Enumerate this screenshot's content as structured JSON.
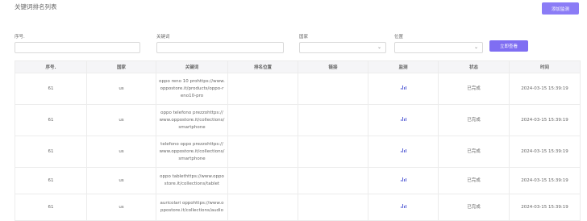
{
  "header": {
    "title": "关键词排名列表",
    "add_button": "添加监测"
  },
  "filters": {
    "seq_label": "序号.",
    "keyword_label": "关键词",
    "country_label": "国家",
    "position_label": "位置",
    "search_button": "立即查看"
  },
  "table": {
    "columns": [
      "序号.",
      "国家",
      "关键词",
      "排名位置",
      "链接",
      "监测",
      "状态",
      "时间"
    ],
    "rows": [
      {
        "id": "61",
        "country": "us",
        "keyword": "oppo reno 10 prohttps://www.oppostore.it/products/oppo-reno10-pro",
        "rank": "",
        "link": "",
        "monitor_icon": "bar-chart-icon",
        "status": "已完成",
        "time": "2024-03-15 15:39:19"
      },
      {
        "id": "61",
        "country": "us",
        "keyword": "oppo telefono prezzohttps://www.oppostore.it/collections/smartphone",
        "rank": "",
        "link": "",
        "monitor_icon": "bar-chart-icon",
        "status": "已完成",
        "time": "2024-03-15 15:39:19"
      },
      {
        "id": "61",
        "country": "us",
        "keyword": "telefono oppo prezzohttps://www.oppostore.it/collections/smartphone",
        "rank": "",
        "link": "",
        "monitor_icon": "bar-chart-icon",
        "status": "已完成",
        "time": "2024-03-15 15:39:19"
      },
      {
        "id": "61",
        "country": "us",
        "keyword": "oppo tablethttps://www.oppostore.it/collections/tablet",
        "rank": "",
        "link": "",
        "monitor_icon": "bar-chart-icon",
        "status": "已完成",
        "time": "2024-03-15 15:39:19"
      },
      {
        "id": "61",
        "country": "us",
        "keyword": "auricolari oppohttps://www.oppostore.it/collections/audio",
        "rank": "",
        "link": "",
        "monitor_icon": "bar-chart-icon",
        "status": "已完成",
        "time": "2024-03-15 15:39:19"
      }
    ]
  }
}
